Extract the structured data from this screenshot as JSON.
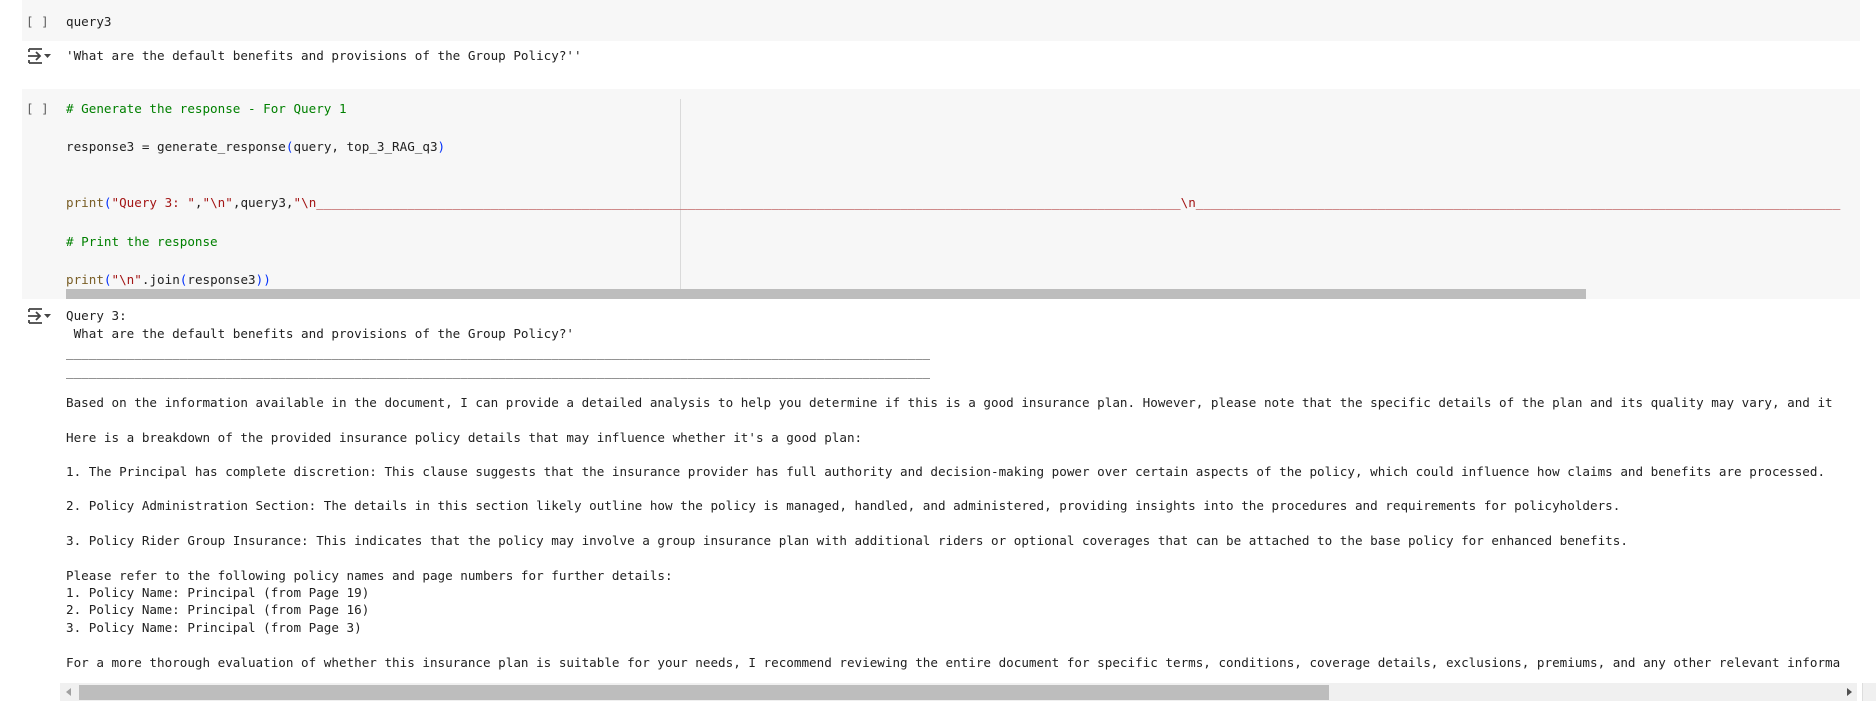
{
  "cell1": {
    "run_marker": "[ ]",
    "code": "query3",
    "output": "'What are the default benefits and provisions of the Group Policy?''"
  },
  "cell2": {
    "run_marker": "[ ]",
    "line1_comment": "# Generate the response - For Query 1",
    "line2_a": "response3 = generate_response",
    "line2_open": "(",
    "line2_args": "query, top_3_RAG_q3",
    "line2_close": ")",
    "line3_print": "print",
    "line3_open": "(",
    "line3_str1": "\"Query 3: \"",
    "line3_sep1": ",",
    "line3_str2": "\"\\n\"",
    "line3_mid": ",query3,",
    "line3_str3": "\"\\n__________________________________________________________________________________________________________________\\n_____________________________________________________________________________________",
    "line4_comment": "# Print the response",
    "line5_print": "print",
    "line5_open": "(",
    "line5_str": "\"\\n\"",
    "line5_join": ".join",
    "line5_open2": "(",
    "line5_arg": "response3",
    "line5_close": "))"
  },
  "output2": {
    "lines": [
      "Query 3:",
      " What are the default benefits and provisions of the Group Policy?'",
      "__________________________________________________________________________________________________________________",
      "__________________________________________________________________________________________________________________",
      "Based on the information available in the document, I can provide a detailed analysis to help you determine if this is a good insurance plan. However, please note that the specific details of the plan and its quality may vary, and it",
      "Here is a breakdown of the provided insurance policy details that may influence whether it's a good plan:",
      "1. The Principal has complete discretion: This clause suggests that the insurance provider has full authority and decision-making power over certain aspects of the policy, which could influence how claims and benefits are processed.",
      "2. Policy Administration Section: The details in this section likely outline how the policy is managed, handled, and administered, providing insights into the procedures and requirements for policyholders.",
      "3. Policy Rider Group Insurance: This indicates that the policy may involve a group insurance plan with additional riders or optional coverages that can be attached to the base policy for enhanced benefits.",
      "Please refer to the following policy names and page numbers for further details:",
      "1. Policy Name: Principal (from Page 19)",
      "2. Policy Name: Principal (from Page 16)",
      "3. Policy Name: Principal (from Page 3)",
      "For a more thorough evaluation of whether this insurance plan is suitable for your needs, I recommend reviewing the entire document for specific terms, conditions, coverage details, exclusions, premiums, and any other relevant informa"
    ]
  },
  "icons": {
    "output_toggle": "output-collapse-icon",
    "scroll_left": "triangle-left",
    "scroll_right": "triangle-right"
  },
  "colors": {
    "comment": "#008000",
    "string": "#a31515",
    "paren": "#0431fa",
    "cell_bg": "#f7f7f7"
  }
}
